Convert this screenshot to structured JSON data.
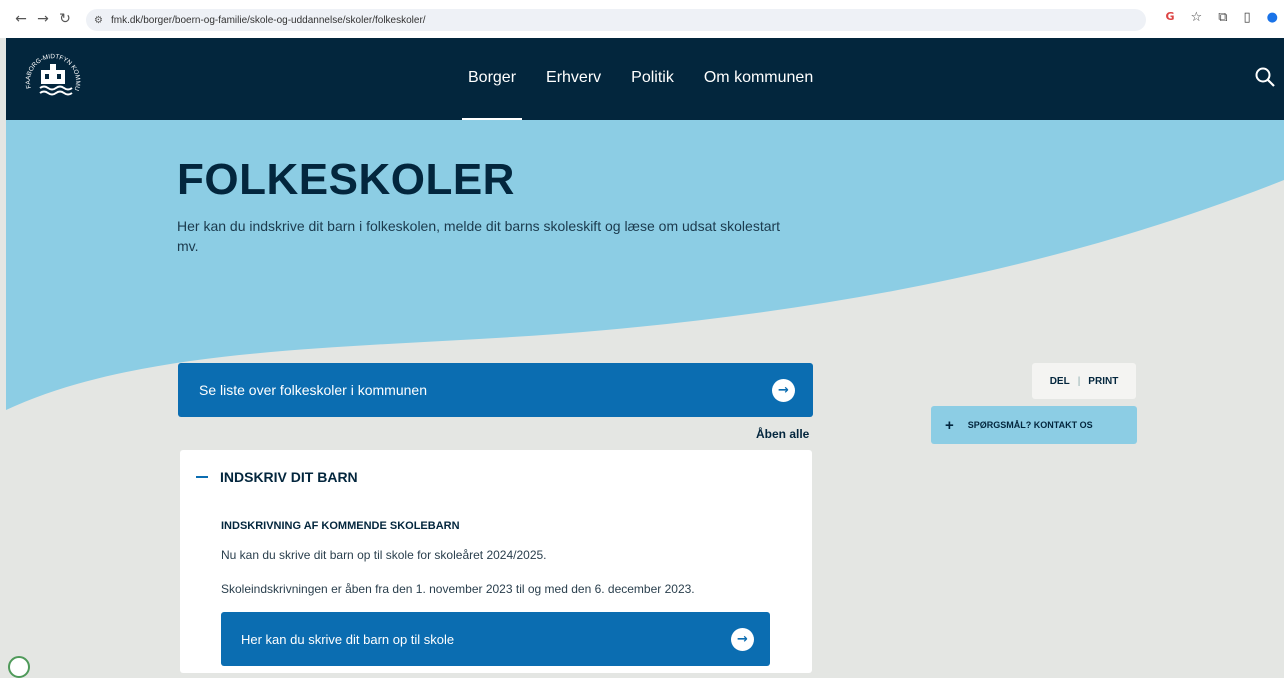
{
  "browser": {
    "url": "fmk.dk/borger/boern-og-familie/skole-og-uddannelse/skoler/folkeskoler/",
    "icons": [
      "back-icon",
      "forward-icon",
      "reload-icon",
      "site-info-icon",
      "google-icon",
      "star-icon",
      "extensions-icon",
      "sidebar-icon",
      "profile-icon"
    ]
  },
  "header": {
    "logo_text": "FAABORG-MIDTFYN KOMMUNE",
    "nav": [
      {
        "label": "Borger",
        "active": true
      },
      {
        "label": "Erhverv"
      },
      {
        "label": "Politik"
      },
      {
        "label": "Om kommunen"
      }
    ],
    "search_icon": "search-icon"
  },
  "hero": {
    "title": "FOLKESKOLER",
    "lead": "Her kan du indskrive dit barn i folkeskolen, melde dit barns skoleskift og læse om udsat skolestart mv.",
    "colors": {
      "wave": "#8ccde4",
      "navy": "#03263d"
    }
  },
  "main": {
    "list_link": "Se liste over folkeskoler i kommunen",
    "open_all": "Åben alle",
    "accordion": {
      "title": "INDSKRIV DIT BARN",
      "subtitle": "INDSKRIVNING AF KOMMENDE SKOLEBARN",
      "para1": "Nu kan du skrive dit barn op til skole for skoleåret 2024/2025.",
      "para2": "Skoleindskrivningen er åben fra den 1. november 2023 til og med den 6. december 2023.",
      "button": "Her kan du skrive dit barn op til skole"
    }
  },
  "aside": {
    "share": "DEL",
    "print": "PRINT",
    "contact": "SPØRGSMÅL? KONTAKT OS"
  }
}
